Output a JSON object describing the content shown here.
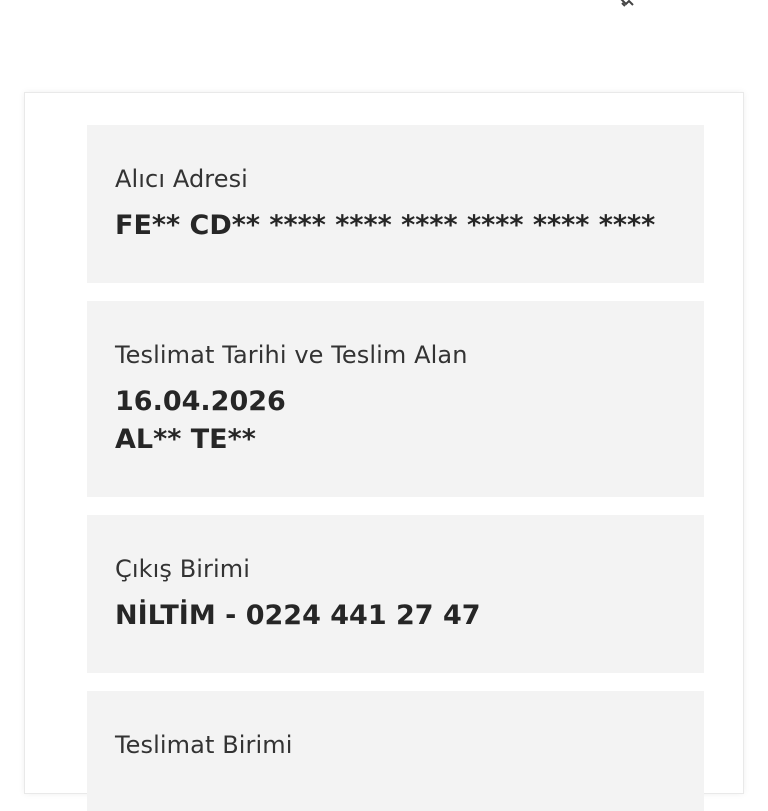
{
  "header": {
    "icon": "wifi-like-icon"
  },
  "address": {
    "label": "Alıcı Adresi",
    "value": "FE** CD** **** **** **** **** **** ****"
  },
  "delivery": {
    "label": "Teslimat Tarihi ve Teslim Alan",
    "date": "16.04.2026",
    "receiver": "AL** TE**"
  },
  "origin": {
    "label": "Çıkış Birimi",
    "value": "NİLTİM - 0224 441 27 47"
  },
  "destination": {
    "label": "Teslimat Birimi"
  },
  "colors": {
    "panel_bg": "#f3f3f3",
    "text_primary": "#262626",
    "text_label": "#333333"
  }
}
